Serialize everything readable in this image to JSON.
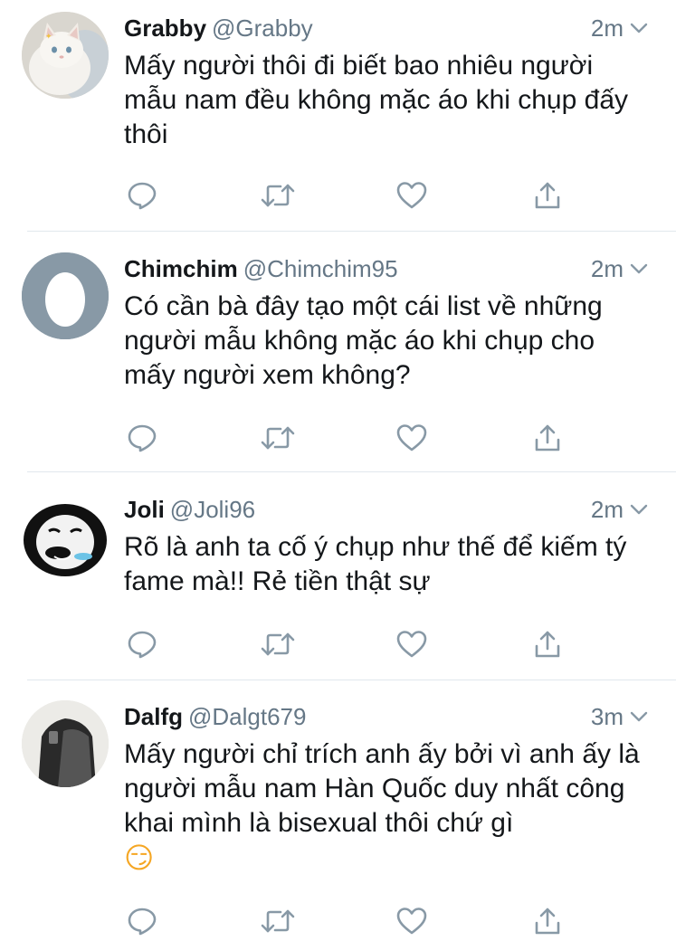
{
  "tweets": [
    {
      "display_name": "Grabby",
      "handle": "@Grabby",
      "time": "2m",
      "text": "Mấy người thôi đi biết bao nhiêu người mẫu nam đều không mặc áo khi chụp đấy thôi",
      "avatar": "white-cat-photo"
    },
    {
      "display_name": "Chimchim",
      "handle": "@Chimchim95",
      "time": "2m",
      "text": "Có cần bà đây tạo một cái list về những người mẫu không mặc áo khi chụp cho mấy người xem không?",
      "avatar": "default-egg-avatar"
    },
    {
      "display_name": "Joli",
      "handle": "@Joli96",
      "time": "2m",
      "text": "Rõ là anh ta cố ý chụp như thế để kiếm tý fame mà!! Rẻ tiền thật sự",
      "avatar": "panda-meme-face"
    },
    {
      "display_name": "Dalfg",
      "handle": "@Dalgt679",
      "time": "3m",
      "text": "Mấy người chỉ trích anh ấy bởi vì anh ấy là người mẫu nam Hàn Quốc duy nhất công khai mình là bisexual thôi chứ gì",
      "emoji": "😏",
      "avatar": "person-photo"
    }
  ],
  "icons": {
    "reply": "reply-icon",
    "retweet": "retweet-icon",
    "like": "like-icon",
    "share": "share-icon",
    "caret": "chevron-down-icon"
  },
  "colors": {
    "text": "#14171a",
    "secondary": "#657786",
    "divider": "#e1e8ed"
  }
}
